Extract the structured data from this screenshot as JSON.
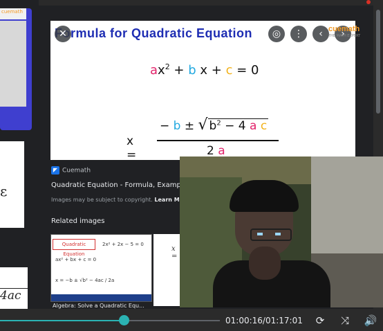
{
  "colors": {
    "accent": "#2bb3b3",
    "title_blue": "#1e2db3",
    "a_color": "#e2236b",
    "b_color": "#23a9e0",
    "c_color": "#f2b21b"
  },
  "left_thumbs": {
    "brand": "cuemath",
    "bottom_text": "4ac"
  },
  "preview": {
    "title": "Formula for Quadratic Equation",
    "eq1": {
      "a": "a",
      "x2": "x",
      "sq": "2",
      "plus1": " + ",
      "b": "b",
      "x": "x",
      "plus2": " + ",
      "c": "c",
      "eq": " = 0"
    },
    "quad": {
      "x_eq": "x =",
      "minus": "−",
      "b": "b",
      "pm": " ± ",
      "b2": "b",
      "sq": "2",
      "minus4": " − 4 ",
      "a": "a",
      "c": "c",
      "two": "2",
      "a_den": "a"
    },
    "logo": "cuemath",
    "logo_tag": "THE MATH EXPERT",
    "close_icon": "close-icon",
    "lens_icon": "lens-icon",
    "share_icon": "share-icon",
    "prev_icon": "chevron-left-icon",
    "next_icon": "chevron-right-icon"
  },
  "source": {
    "site": "Cuemath",
    "title": "Quadratic Equation - Formula, Examp",
    "copyright": "Images may be subject to copyright.",
    "learn_more": "Learn M"
  },
  "related": {
    "heading": "Related images",
    "item1": {
      "head": "Quadratic Equation",
      "line1": "ax² + bx + c = 0",
      "line2": "x = −b ± √b² − 4ac / 2a",
      "line3": "2x² + 2x − 5 = 0",
      "caption": "Algebra: Solve a Quadratic Equ..."
    },
    "item2": {
      "text": "x ="
    }
  },
  "player": {
    "time": "01:00:16/01:17:01",
    "progress": 0.56
  }
}
